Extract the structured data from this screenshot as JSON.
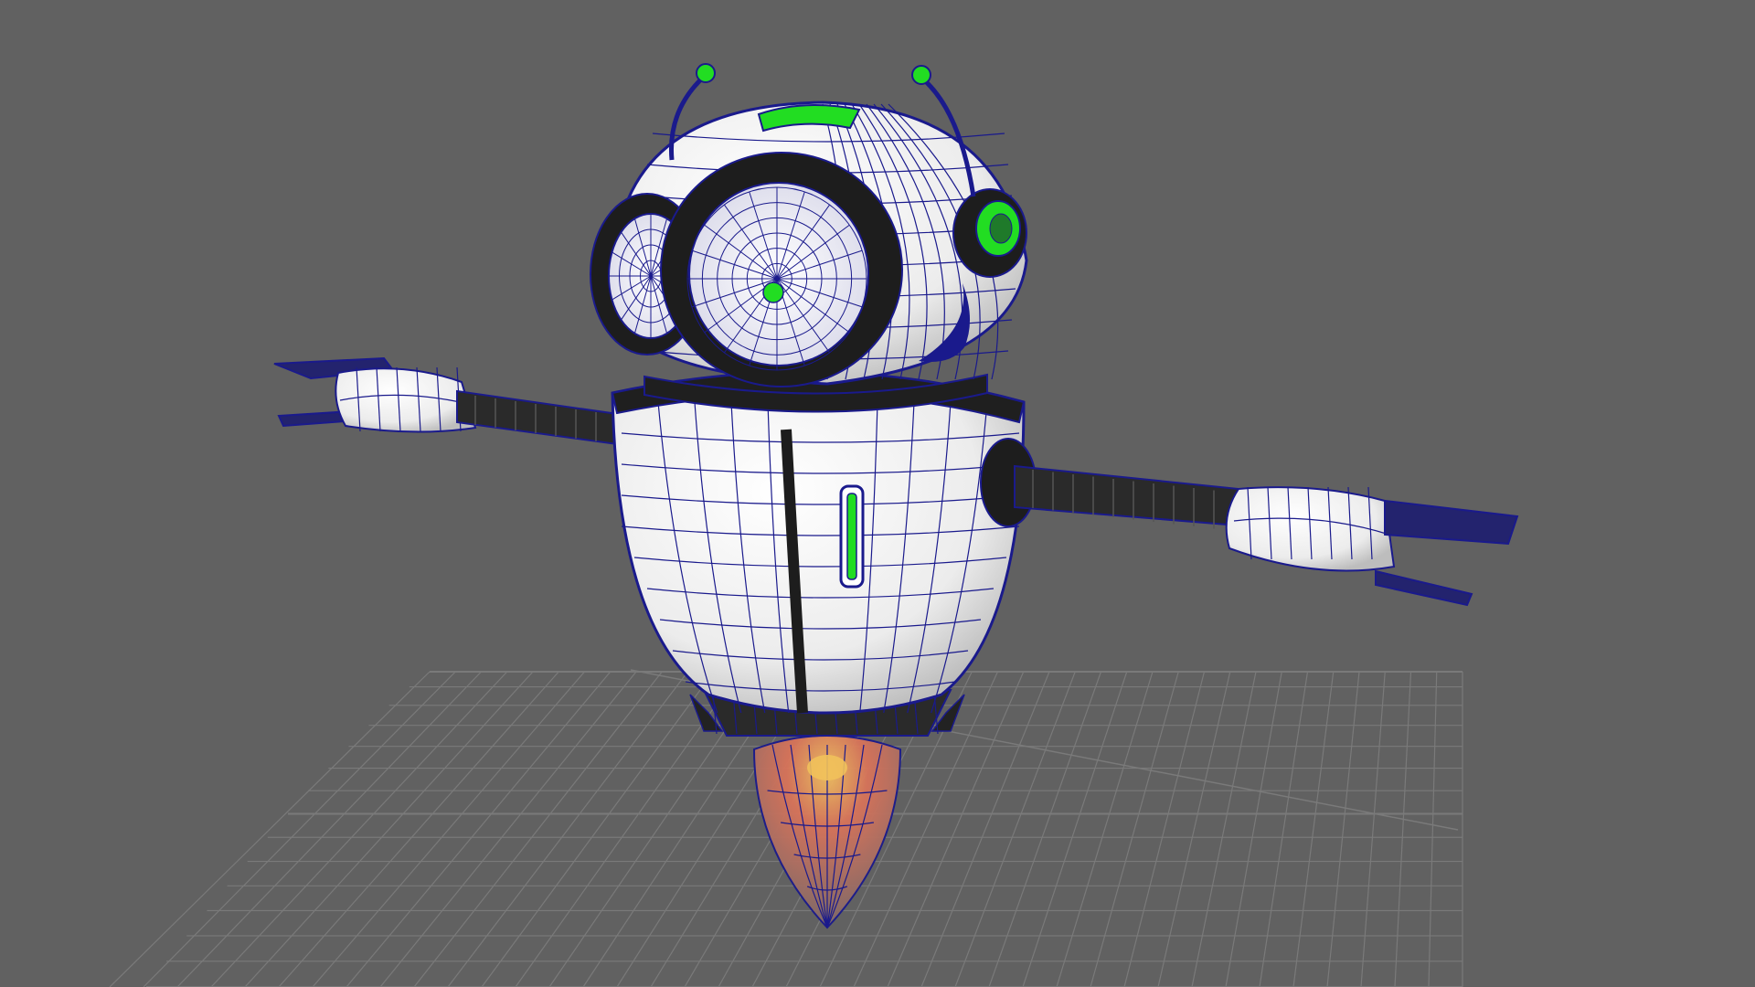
{
  "viewport": {
    "background_color": "#616161",
    "grid_color": "#7a7a7a",
    "wire_color": "#1a1a8c",
    "selection_highlight_color": "#22dd22",
    "shell_color": "#f4f4f4",
    "dark_part_color": "#222222",
    "thruster_flame_color": "#d8735a"
  },
  "model": {
    "icon": "robot-icon",
    "parts": [
      {
        "part": "head",
        "icon": "sphere-icon"
      },
      {
        "part": "body",
        "icon": "capsule-icon"
      },
      {
        "part": "left-arm",
        "icon": "arm-icon"
      },
      {
        "part": "right-arm",
        "icon": "arm-icon"
      },
      {
        "part": "thruster",
        "icon": "flame-icon"
      },
      {
        "part": "antennas",
        "icon": "antenna-icon"
      }
    ]
  }
}
